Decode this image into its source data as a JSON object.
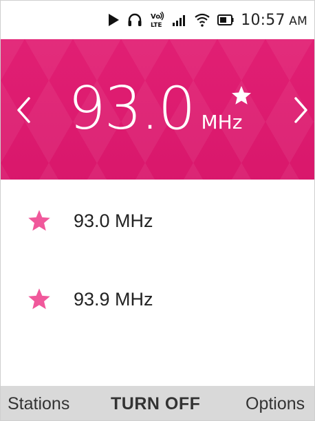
{
  "status_bar": {
    "time": "10:57",
    "ampm": "AM",
    "icons": [
      "play-icon",
      "headphones-icon",
      "volte-icon",
      "signal-icon",
      "wifi-icon",
      "battery-icon"
    ],
    "volte_label_top": "Vo",
    "volte_label_bottom": "LTE"
  },
  "header": {
    "background_color": "#e0186f",
    "frequency": "93.0",
    "unit": "MHz",
    "favorite": true,
    "prev_icon": "chevron-left-icon",
    "next_icon": "chevron-right-icon"
  },
  "stations": [
    {
      "label": "93.0 MHz",
      "icon": "star-icon",
      "star_color": "#f0589b"
    },
    {
      "label": "93.9 MHz",
      "icon": "star-icon",
      "star_color": "#f0589b"
    }
  ],
  "softkeys": {
    "left": "Stations",
    "center": "TURN OFF",
    "right": "Options",
    "background": "#d9d9d9"
  }
}
